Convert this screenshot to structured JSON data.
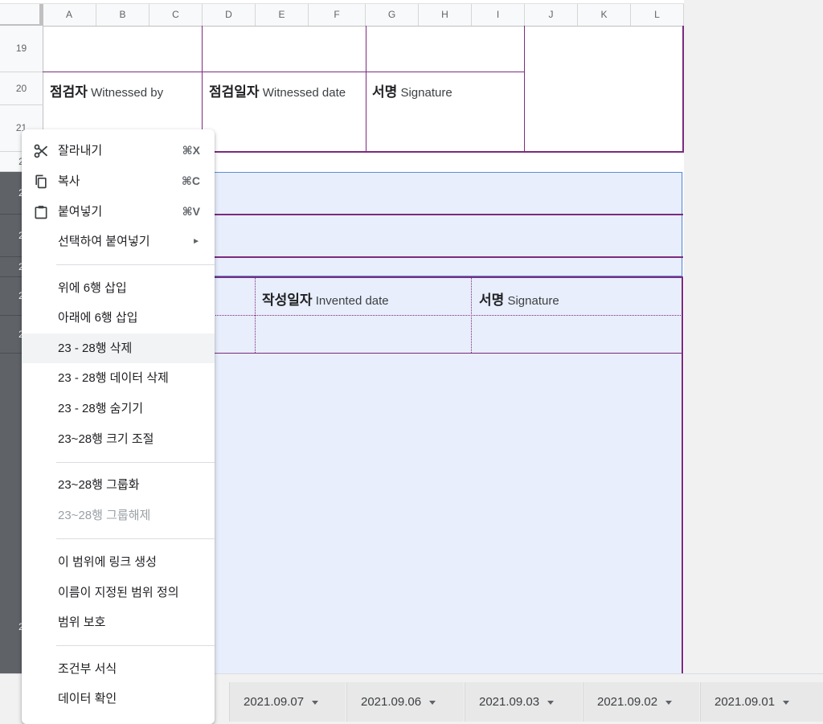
{
  "columns": [
    "A",
    "B",
    "C",
    "D",
    "E",
    "F",
    "G",
    "H",
    "I",
    "J",
    "K",
    "L"
  ],
  "rows": {
    "r19": "19",
    "r20": "20",
    "r21": "21",
    "r22": "2",
    "r23": "2",
    "r24": "2",
    "r25": "2",
    "r26": "2",
    "r27": "2",
    "r28": "2"
  },
  "cells": {
    "witnessed_by_ko": "점검자",
    "witnessed_by_en": "Witnessed by",
    "witnessed_date_ko": "점검일자",
    "witnessed_date_en": "Witnessed date",
    "signature1_ko": "서명",
    "signature1_en": "Signature",
    "invented_date_ko": "작성일자",
    "invented_date_en": "Invented date",
    "signature2_ko": "서명",
    "signature2_en": "Signature"
  },
  "context_menu": {
    "cut": {
      "label": "잘라내기",
      "shortcut": "⌘X"
    },
    "copy": {
      "label": "복사",
      "shortcut": "⌘C"
    },
    "paste": {
      "label": "붙여넣기",
      "shortcut": "⌘V"
    },
    "paste_special": {
      "label": "선택하여 붙여넣기",
      "arrow": "►"
    },
    "insert_above": "위에 6행 삽입",
    "insert_below": "아래에 6행 삽입",
    "delete_rows": "23 - 28행 삭제",
    "clear_rows": "23 - 28행 데이터 삭제",
    "hide_rows": "23 - 28행 숨기기",
    "resize_rows": "23~28행 크기 조절",
    "group_rows": "23~28행 그룹화",
    "ungroup_rows": "23~28행 그룹해제",
    "link_range": "이 범위에 링크 생성",
    "named_range": "이름이 지정된 범위 정의",
    "protect_range": "범위 보호",
    "conditional_format": "조건부 서식",
    "data_validation": "데이터 확인"
  },
  "sheet_tabs": [
    "2021.09.07",
    "2021.09.06",
    "2021.09.03",
    "2021.09.02",
    "2021.09.01"
  ],
  "colors": {
    "accent_border": "#7b2b7e",
    "selection": "#e8eefb",
    "selection_border": "#5c8fd6"
  }
}
